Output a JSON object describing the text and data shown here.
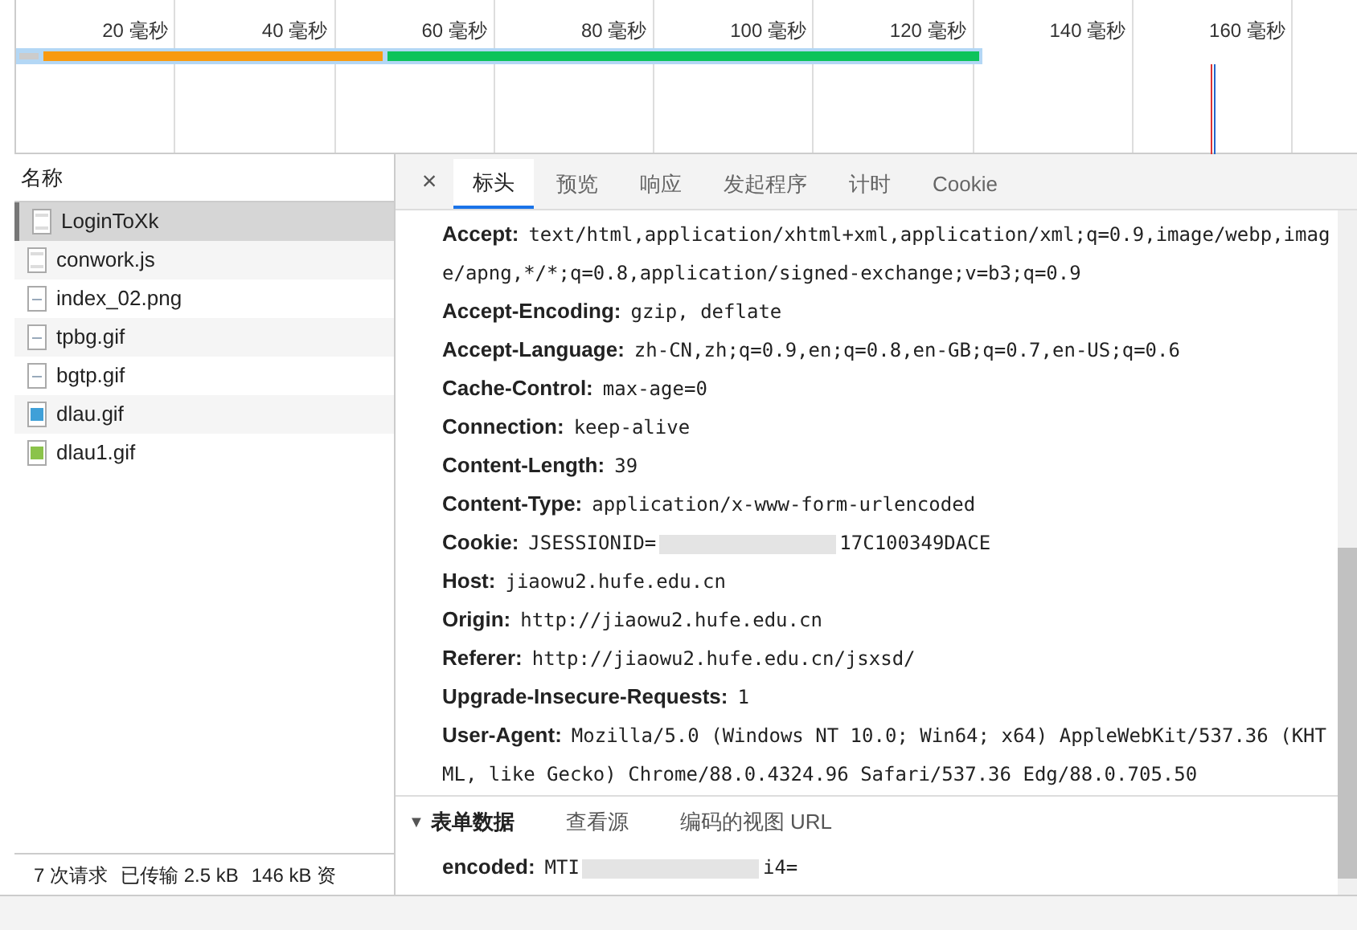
{
  "timeline": {
    "ticks": [
      "20 毫秒",
      "40 毫秒",
      "60 毫秒",
      "80 毫秒",
      "100 毫秒",
      "120 毫秒",
      "140 毫秒",
      "160 毫秒"
    ]
  },
  "requests": {
    "header": "名称",
    "items": [
      {
        "name": "LoginToXk",
        "kind": "doc",
        "selected": true
      },
      {
        "name": "conwork.js",
        "kind": "doc",
        "selected": false
      },
      {
        "name": "index_02.png",
        "kind": "image",
        "selected": false
      },
      {
        "name": "tpbg.gif",
        "kind": "image",
        "selected": false
      },
      {
        "name": "bgtp.gif",
        "kind": "image",
        "selected": false
      },
      {
        "name": "dlau.gif",
        "kind": "blue",
        "selected": false
      },
      {
        "name": "dlau1.gif",
        "kind": "green",
        "selected": false
      }
    ],
    "status": [
      "7 次请求",
      "已传输 2.5 kB",
      "146 kB 资"
    ]
  },
  "details": {
    "close": "×",
    "tabs": [
      {
        "label": "标头",
        "selected": true
      },
      {
        "label": "预览",
        "selected": false
      },
      {
        "label": "响应",
        "selected": false
      },
      {
        "label": "发起程序",
        "selected": false
      },
      {
        "label": "计时",
        "selected": false
      },
      {
        "label": "Cookie",
        "selected": false
      }
    ],
    "headers": [
      {
        "name": "Accept:",
        "value": "text/html,application/xhtml+xml,application/xml;q=0.9,image/webp,image/apng,*/*;q=0.8,application/signed-exchange;v=b3;q=0.9"
      },
      {
        "name": "Accept-Encoding:",
        "value": "gzip, deflate"
      },
      {
        "name": "Accept-Language:",
        "value": "zh-CN,zh;q=0.9,en;q=0.8,en-GB;q=0.7,en-US;q=0.6"
      },
      {
        "name": "Cache-Control:",
        "value": "max-age=0"
      },
      {
        "name": "Connection:",
        "value": "keep-alive"
      },
      {
        "name": "Content-Length:",
        "value": "39"
      },
      {
        "name": "Content-Type:",
        "value": "application/x-www-form-urlencoded"
      },
      {
        "name": "Cookie:",
        "value": "JSESSIONID=",
        "value_end": "17C100349DACE",
        "redacted": true
      },
      {
        "name": "Host:",
        "value": "jiaowu2.hufe.edu.cn"
      },
      {
        "name": "Origin:",
        "value": "http://jiaowu2.hufe.edu.cn"
      },
      {
        "name": "Referer:",
        "value": "http://jiaowu2.hufe.edu.cn/jsxsd/"
      },
      {
        "name": "Upgrade-Insecure-Requests:",
        "value": "1"
      },
      {
        "name": "User-Agent:",
        "value": "Mozilla/5.0 (Windows NT 10.0; Win64; x64) AppleWebKit/537.36 (KHTML, like Gecko) Chrome/88.0.4324.96 Safari/537.36 Edg/88.0.705.50"
      }
    ],
    "form": {
      "toggle": "▼",
      "title": "表单数据",
      "expanded": true,
      "links": [
        "查看源",
        "编码的视图 URL"
      ],
      "fields": [
        {
          "name": "encoded:",
          "value": "MTI",
          "value_end": "i4=",
          "redacted": true
        }
      ]
    }
  }
}
